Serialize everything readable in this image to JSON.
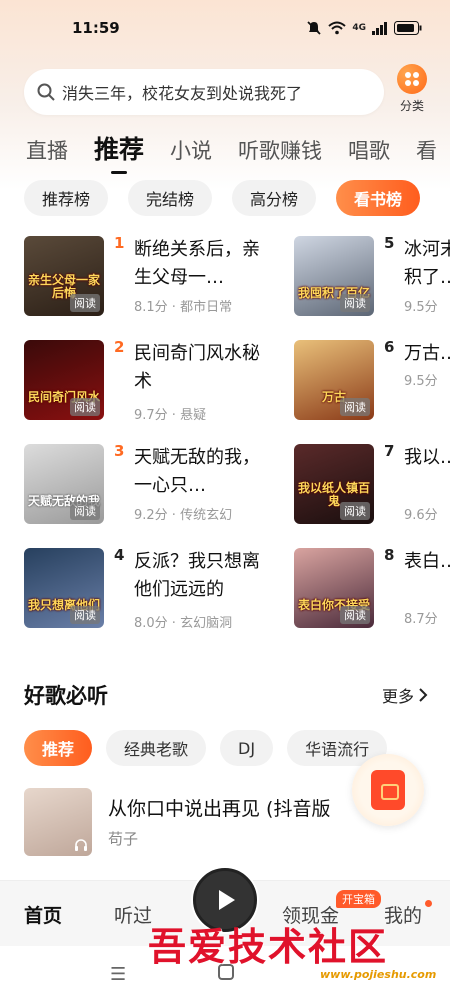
{
  "status_bar": {
    "time": "11:59",
    "network": "4G"
  },
  "search": {
    "placeholder": "消失三年，校花女友到处说我死了",
    "category_label": "分类"
  },
  "tabs": [
    "直播",
    "推荐",
    "小说",
    "听歌赚钱",
    "唱歌",
    "看"
  ],
  "active_tab": "推荐",
  "chips": [
    "推荐榜",
    "完结榜",
    "高分榜",
    "看书榜"
  ],
  "active_chip": "看书榜",
  "read_badge": "阅读",
  "books": [
    {
      "rank": "1",
      "title": "断绝关系后，亲生父母一…",
      "meta": "8.1分 · 都市日常",
      "cover_text": "亲生父母一家后悔"
    },
    {
      "rank": "2",
      "title": "民间奇门风水秘术",
      "meta": "9.7分 · 悬疑",
      "cover_text": "民间奇门风水"
    },
    {
      "rank": "3",
      "title": "天赋无敌的我，一心只…",
      "meta": "9.2分 · 传统玄幻",
      "cover_text": "天赋无敌的我"
    },
    {
      "rank": "4",
      "title": "反派？我只想离他们远远的",
      "meta": "8.0分 · 玄幻脑洞",
      "cover_text": "我只想离他们"
    },
    {
      "rank": "5",
      "title": "冰河末世：我囤积了…",
      "meta": "9.5分",
      "cover_text": "我囤积了百亿"
    },
    {
      "rank": "6",
      "title": "万古…",
      "meta": "9.5分",
      "cover_text": "万古"
    },
    {
      "rank": "7",
      "title": "我以…鬼",
      "meta": "9.6分",
      "cover_text": "我以纸人镇百鬼"
    },
    {
      "rank": "8",
      "title": "表白…受，",
      "meta": "8.7分",
      "cover_text": "表白你不接受"
    }
  ],
  "songs_section": {
    "title": "好歌必听",
    "more": "更多"
  },
  "song_chips": [
    "推荐",
    "经典老歌",
    "DJ",
    "华语流行"
  ],
  "active_song_chip": "推荐",
  "song": {
    "title": "从你口中说出再见 (抖音版",
    "artist": "苟子"
  },
  "bottom_nav": {
    "home": "首页",
    "listened": "听过",
    "cash": "领现金",
    "mine": "我的",
    "treasure_badge": "开宝箱"
  },
  "watermark": {
    "text": "吾爱技术社区",
    "url": "www.pojieshu.com"
  },
  "colors": {
    "accent": "#ff5d1e",
    "rank_top": "#ff6a22"
  }
}
